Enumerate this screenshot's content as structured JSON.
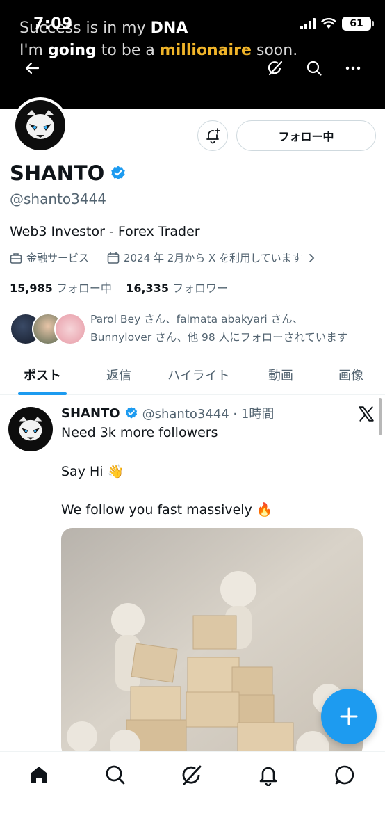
{
  "status_bar": {
    "time": "7:09",
    "battery": "61"
  },
  "banner": {
    "line1_pre": "Success is in my ",
    "line1_bold": "DNA",
    "line2_pre": "I'm ",
    "line2_bold": "going",
    "line2_mid": " to be a ",
    "line2_gold": "millionaire",
    "line2_post": " soon."
  },
  "profile": {
    "follow_button": "フォロー中",
    "display_name": "SHANTO",
    "handle": "@shanto3444",
    "bio": "Web3 Investor - Forex Trader",
    "category": "金融サービス",
    "joined": "2024 年 2月から X を利用しています",
    "following_count": "15,985",
    "following_label": "フォロー中",
    "followers_count": "16,335",
    "followers_label": "フォロワー",
    "followed_by_line1": "Parol Bey さん、falmata abakyari さん、",
    "followed_by_line2": "Bunnylover さん、他 98 人にフォローされています"
  },
  "tabs": [
    {
      "label": "ポスト",
      "active": true
    },
    {
      "label": "返信",
      "active": false
    },
    {
      "label": "ハイライト",
      "active": false
    },
    {
      "label": "動画",
      "active": false
    },
    {
      "label": "画像",
      "active": false
    }
  ],
  "post": {
    "name": "SHANTO",
    "handle_time": "@shanto3444 · 1時間",
    "line1": "Need 3k more followers",
    "line2": "Say Hi 👋",
    "line3": "We follow you fast massively 🔥"
  },
  "colors": {
    "accent": "#1d9bf0",
    "gold": "#f0b429",
    "muted": "#536471"
  },
  "icons": [
    "back-arrow-icon",
    "grok-icon",
    "search-icon",
    "more-icon",
    "notification-plus-icon",
    "verified-badge-icon",
    "briefcase-icon",
    "calendar-icon",
    "chevron-right-icon",
    "x-logo-icon",
    "compose-plus-icon",
    "home-icon",
    "bell-icon",
    "message-icon"
  ]
}
